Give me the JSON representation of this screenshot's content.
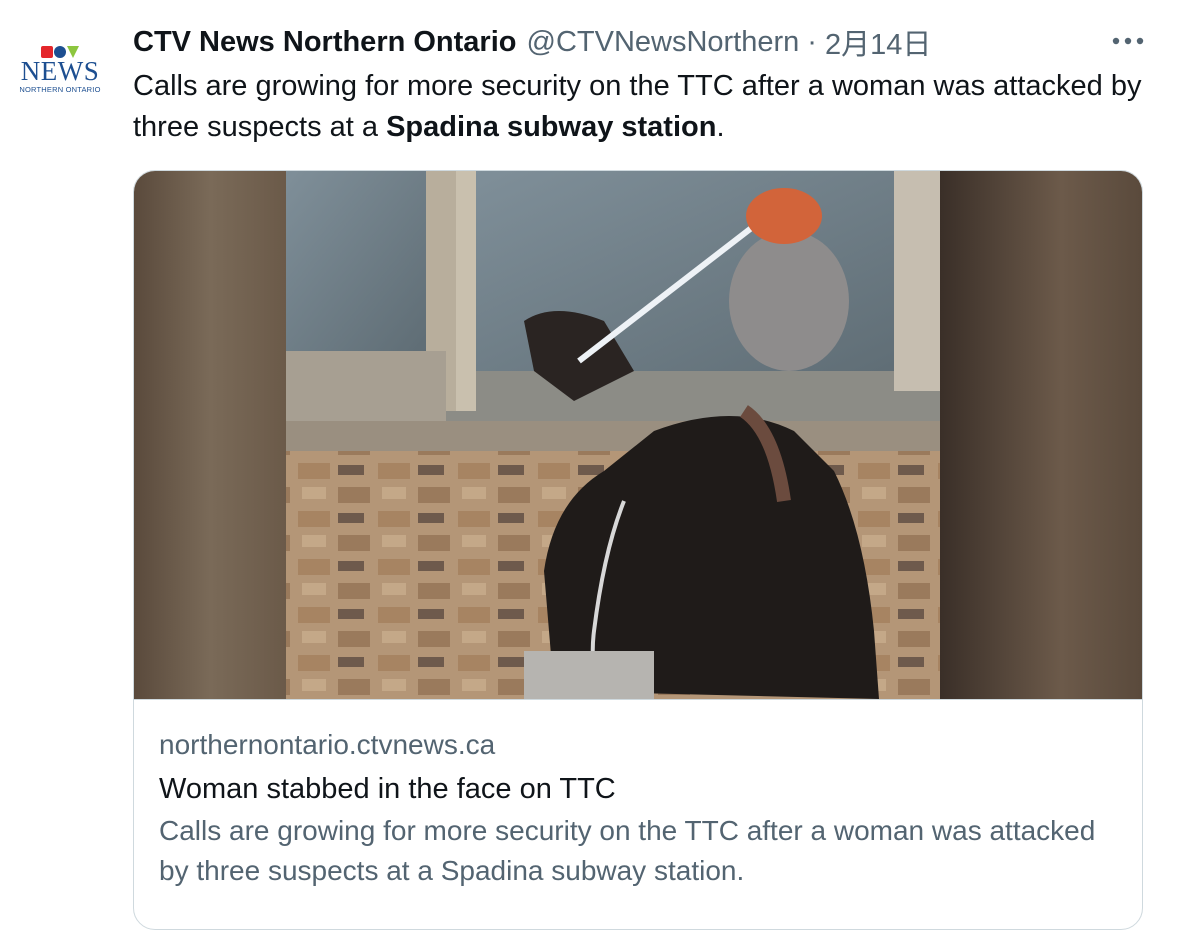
{
  "tweet": {
    "author": {
      "avatar_logo_text": "CTV",
      "avatar_word": "NEWS",
      "avatar_region": "NORTHERN ONTARIO",
      "display_name": "CTV News Northern Ontario",
      "handle": "@CTVNewsNorthern",
      "separator": "·",
      "date": "2月14日"
    },
    "more_icon": "more-horizontal-icon",
    "text": {
      "part1": "Calls are growing for more security on the TTC after a woman was attacked by three suspects at a ",
      "bold": "Spadina subway station",
      "part2": "."
    },
    "card": {
      "image_alt": "Security camera image of a suspect in a subway station",
      "domain": "northernontario.ctvnews.ca",
      "title": "Woman stabbed in the face on TTC",
      "description": "Calls are growing for more security on the TTC after a woman was attacked by three suspects at a Spadina subway station."
    }
  },
  "colors": {
    "text_primary": "#0f1419",
    "text_secondary": "#536471",
    "border": "#cfd9de",
    "brand_blue": "#1d4f91"
  }
}
